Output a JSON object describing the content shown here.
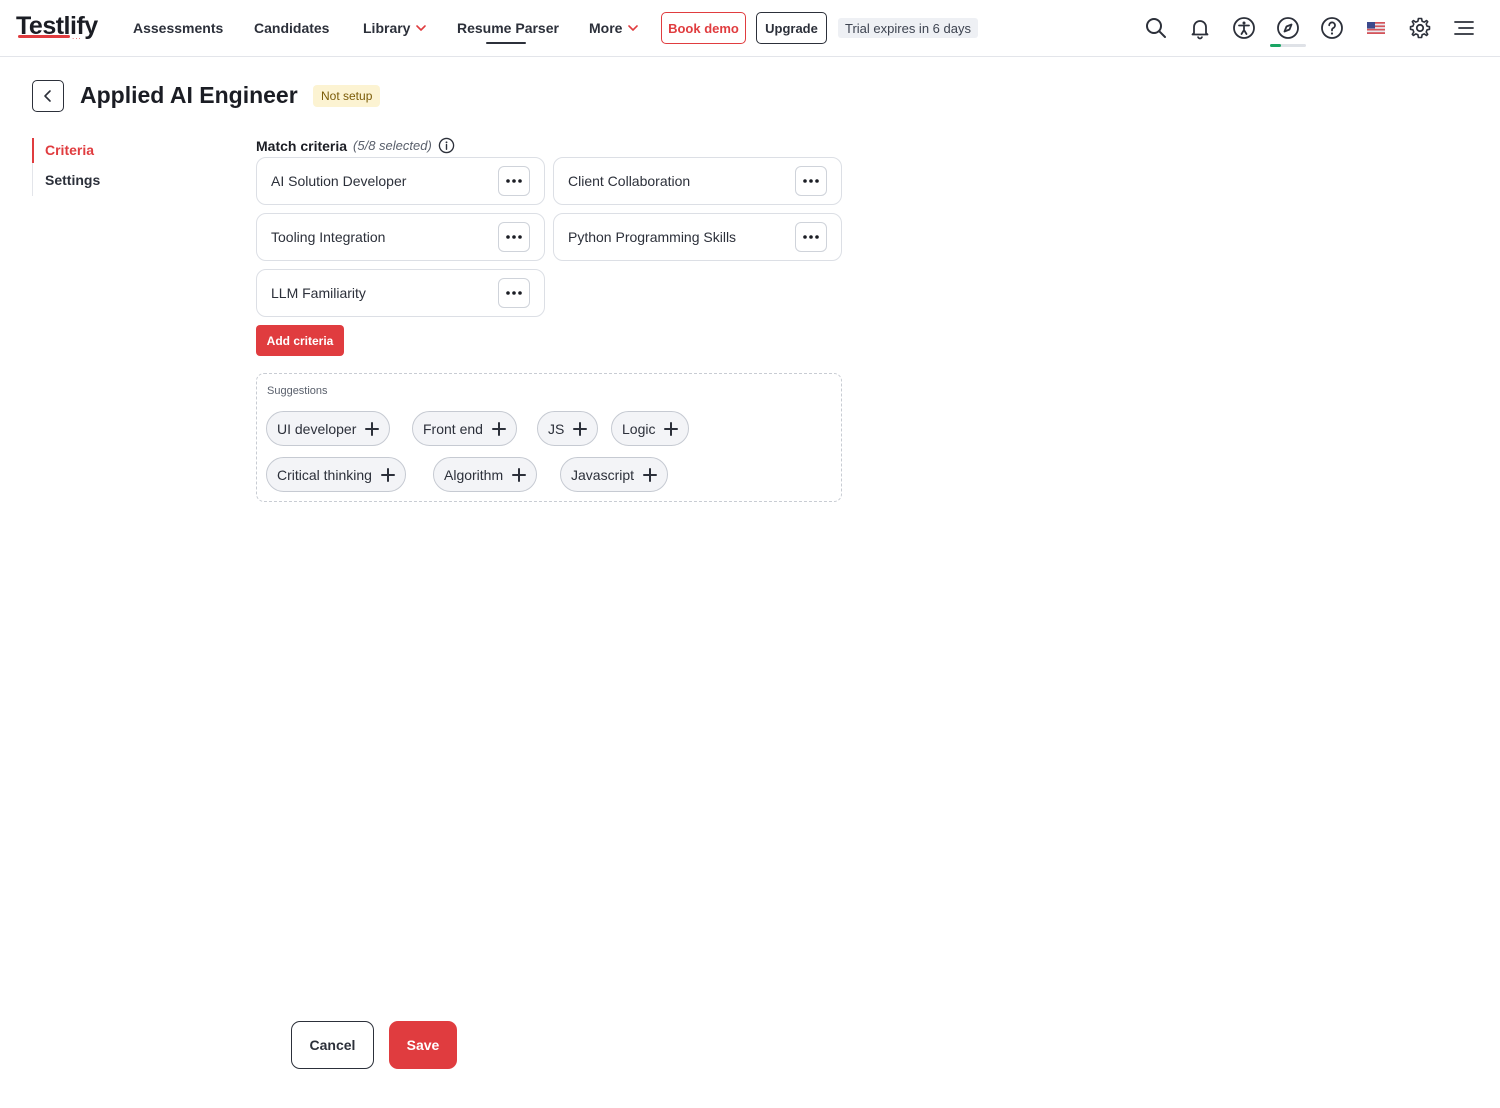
{
  "app": {
    "logo": "Testlify"
  },
  "nav": {
    "items": [
      {
        "label": "Assessments",
        "has_dropdown": false
      },
      {
        "label": "Candidates",
        "has_dropdown": false
      },
      {
        "label": "Library",
        "has_dropdown": true
      },
      {
        "label": "Resume Parser",
        "has_dropdown": false,
        "active": true
      },
      {
        "label": "More",
        "has_dropdown": true
      }
    ],
    "book_demo": "Book demo",
    "upgrade": "Upgrade",
    "trial": "Trial expires in 6 days",
    "icons": [
      "search-icon",
      "bell-icon",
      "accessibility-icon",
      "compass-icon",
      "help-icon",
      "us-flag-icon",
      "gear-icon",
      "menu-icon"
    ],
    "onboarding_progress": 0.3,
    "colors": {
      "accent": "#e03c3f",
      "progress": "#1aa564"
    }
  },
  "header": {
    "title": "Applied AI Engineer",
    "status": "Not setup"
  },
  "sidebar": {
    "tabs": [
      {
        "label": "Criteria",
        "active": true
      },
      {
        "label": "Settings",
        "active": false
      }
    ]
  },
  "criteria": {
    "label": "Match criteria",
    "count_text": "(5/8 selected)",
    "items": [
      "AI Solution Developer",
      "Client Collaboration",
      "Tooling Integration",
      "Python Programming Skills",
      "LLM Familiarity"
    ],
    "add_label": "Add criteria"
  },
  "suggestions": {
    "title": "Suggestions",
    "chips": [
      "UI developer",
      "Front end",
      "JS",
      "Logic",
      "Critical thinking",
      "Algorithm",
      "Javascript"
    ]
  },
  "footer": {
    "cancel": "Cancel",
    "save": "Save"
  }
}
